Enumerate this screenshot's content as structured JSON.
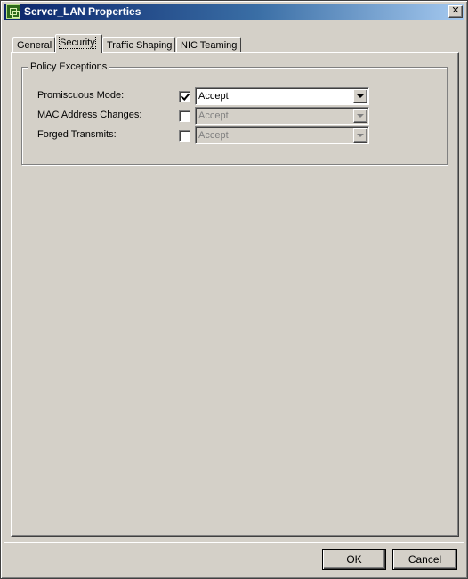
{
  "window": {
    "title": "Server_LAN Properties",
    "icon": "network-properties-icon",
    "close_glyph": "✕"
  },
  "tabs": [
    {
      "label": "General",
      "active": false
    },
    {
      "label": "Security",
      "active": true
    },
    {
      "label": "Traffic Shaping",
      "active": false
    },
    {
      "label": "NIC Teaming",
      "active": false
    }
  ],
  "policy": {
    "group_title": "Policy Exceptions",
    "rows": [
      {
        "label": "Promiscuous Mode:",
        "checked": true,
        "value": "Accept",
        "enabled": true
      },
      {
        "label": "MAC Address Changes:",
        "checked": false,
        "value": "Accept",
        "enabled": false
      },
      {
        "label": "Forged Transmits:",
        "checked": false,
        "value": "Accept",
        "enabled": false
      }
    ]
  },
  "buttons": {
    "ok": "OK",
    "cancel": "Cancel"
  },
  "colors": {
    "titlebar_start": "#0a246a",
    "titlebar_end": "#a6caf0",
    "face": "#d4d0c8"
  }
}
